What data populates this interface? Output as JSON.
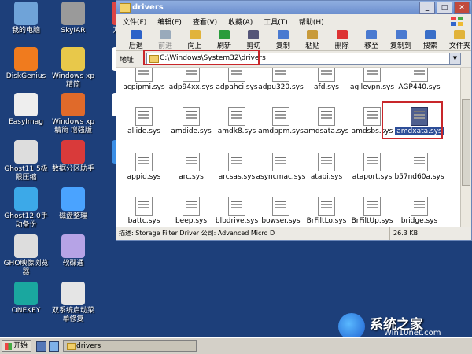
{
  "desktop": {
    "icons": [
      {
        "label": "我的电脑",
        "icon": "computer-icon",
        "color": "#6fa3d8"
      },
      {
        "label": "SkyIAR",
        "icon": "drive-icon",
        "color": "#9a9a9a"
      },
      {
        "label": "万能驱",
        "icon": "driver-icon",
        "color": "#d44"
      },
      {
        "label": "DiskGenius",
        "icon": "diskgenius-icon",
        "color": "#f07b1e"
      },
      {
        "label": "Windows xp精简",
        "icon": "broom-icon",
        "color": "#e8c84a"
      },
      {
        "label": "压缩",
        "icon": "compress-icon",
        "color": "#fff"
      },
      {
        "label": "EasyImag",
        "icon": "ghost-icon",
        "color": "#eee"
      },
      {
        "label": "Windows xp精简 增强版",
        "icon": "ubuntu-icon",
        "color": "#e06a2a"
      },
      {
        "label": "一键",
        "icon": "tool-icon",
        "color": "#fff"
      },
      {
        "label": "Ghost11.5极限压缩",
        "icon": "ghost-icon",
        "color": "#ddd"
      },
      {
        "label": "数据分区助手",
        "icon": "partition-icon",
        "color": "#d93a3a"
      },
      {
        "label": "映像",
        "icon": "image-icon",
        "color": "#3a8ee6"
      },
      {
        "label": "Ghost12.0手动备份",
        "icon": "bird-icon",
        "color": "#3ca9e8"
      },
      {
        "label": "磁盘整理",
        "icon": "blocks-icon",
        "color": "#4aa3ff"
      },
      {
        "label": "GHO映像浏览器",
        "icon": "ghost-icon",
        "color": "#ddd"
      },
      {
        "label": "软碟通",
        "icon": "disc-icon",
        "color": "#b6a3e6"
      },
      {
        "label": "ONEKEY",
        "icon": "onekey-icon",
        "color": "#1aa79f"
      },
      {
        "label": "双系统启动菜单修复",
        "icon": "firstaid-icon",
        "color": "#e5e5e5"
      }
    ]
  },
  "window": {
    "title": "drivers",
    "menu": [
      "文件(F)",
      "编辑(E)",
      "查看(V)",
      "收藏(A)",
      "工具(T)",
      "帮助(H)"
    ],
    "toolbar": [
      {
        "label": "后退",
        "icon": "back-icon",
        "color": "#2d62c8",
        "enabled": true
      },
      {
        "label": "前进",
        "icon": "forward-icon",
        "color": "#9ab",
        "enabled": false
      },
      {
        "label": "向上",
        "icon": "up-folder-icon",
        "color": "#e1b33a",
        "enabled": true
      },
      {
        "label": "刷新",
        "icon": "refresh-icon",
        "color": "#2a9c3b",
        "enabled": true
      },
      {
        "label": "剪切",
        "icon": "cut-icon",
        "color": "#557",
        "enabled": true
      },
      {
        "label": "复制",
        "icon": "copy-icon",
        "color": "#4a7ad0",
        "enabled": true
      },
      {
        "label": "粘贴",
        "icon": "paste-icon",
        "color": "#c89a3a",
        "enabled": true
      },
      {
        "label": "删除",
        "icon": "delete-icon",
        "color": "#d33",
        "enabled": true
      },
      {
        "label": "移至",
        "icon": "move-icon",
        "color": "#4a7ad0",
        "enabled": true
      },
      {
        "label": "复制到",
        "icon": "copy-to-icon",
        "color": "#4a7ad0",
        "enabled": true
      },
      {
        "label": "搜索",
        "icon": "search-icon",
        "color": "#3a6fc8",
        "enabled": true
      },
      {
        "label": "文件夹",
        "icon": "folders-icon",
        "color": "#e1b33a",
        "enabled": true
      }
    ],
    "address": {
      "label": "地址",
      "value": "C:\\Windows\\System32\\drivers"
    },
    "files": [
      "acpipmi.sys",
      "adp94xx.sys",
      "adpahci.sys",
      "adpu320.sys",
      "afd.sys",
      "agilevpn.sys",
      "AGP440.sys",
      "aliide.sys",
      "amdide.sys",
      "amdk8.sys",
      "amdppm.sys",
      "amdsata.sys",
      "amdsbs.sys",
      "amdxata.sys",
      "appid.sys",
      "arc.sys",
      "arcsas.sys",
      "asyncmac.sys",
      "atapi.sys",
      "ataport.sys",
      "b57nd60a.sys",
      "battc.sys",
      "beep.sys",
      "blbdrive.sys",
      "bowser.sys",
      "BrFiltLo.sys",
      "BrFiltUp.sys",
      "bridge.sys"
    ],
    "selected_file": "amdxata.sys",
    "status": {
      "description": "描述: Storage Filter Driver 公司: Advanced Micro D",
      "size": "26.3 KB"
    }
  },
  "taskbar": {
    "start": "开始",
    "items": [
      "drivers"
    ]
  },
  "watermark": {
    "title": "系统之家",
    "url": "Win10net.com"
  }
}
